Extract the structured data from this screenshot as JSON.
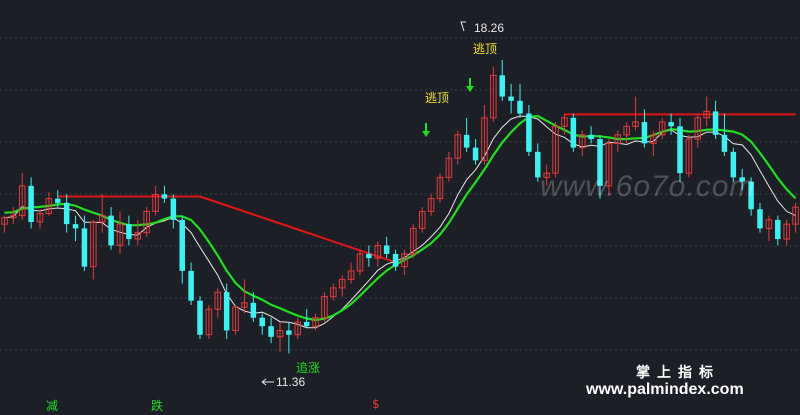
{
  "chart_data": {
    "type": "candlestick",
    "colors": {
      "up": "#e23b3b",
      "down": "#3ff0f0",
      "ma_white": "#e8e8e8",
      "ma_green": "#22dd22",
      "resistance": "#e01515",
      "grid": "#3a3f4a",
      "label_yellow": "#f0e030",
      "label_green": "#22dd22",
      "arrow_green": "#22dd22"
    },
    "grid": "dotted-horizontal",
    "price_range": [
      10.5,
      19.2
    ],
    "candles": [
      [
        14.4,
        14.6,
        14.2,
        14.55
      ],
      [
        14.55,
        14.8,
        14.4,
        14.6
      ],
      [
        14.6,
        15.6,
        14.5,
        15.3
      ],
      [
        15.3,
        15.5,
        14.3,
        14.45
      ],
      [
        14.45,
        14.75,
        14.3,
        14.65
      ],
      [
        14.65,
        15.15,
        14.6,
        15.0
      ],
      [
        15.0,
        15.2,
        14.8,
        14.9
      ],
      [
        14.9,
        15.1,
        14.2,
        14.4
      ],
      [
        14.4,
        14.6,
        14.0,
        14.3
      ],
      [
        14.3,
        14.6,
        13.3,
        13.4
      ],
      [
        13.4,
        14.5,
        13.1,
        14.45
      ],
      [
        14.45,
        15.1,
        14.2,
        14.6
      ],
      [
        14.6,
        14.8,
        13.8,
        13.9
      ],
      [
        13.9,
        14.7,
        13.7,
        14.4
      ],
      [
        14.4,
        14.6,
        13.9,
        14.05
      ],
      [
        14.05,
        14.5,
        13.9,
        14.2
      ],
      [
        14.2,
        14.8,
        14.1,
        14.7
      ],
      [
        14.7,
        15.3,
        14.6,
        15.1
      ],
      [
        15.1,
        15.3,
        14.9,
        15.0
      ],
      [
        15.0,
        15.1,
        14.3,
        14.5
      ],
      [
        14.5,
        14.6,
        13.0,
        13.3
      ],
      [
        13.3,
        13.5,
        12.5,
        12.6
      ],
      [
        12.6,
        12.7,
        11.7,
        11.8
      ],
      [
        11.8,
        12.5,
        11.7,
        12.4
      ],
      [
        12.4,
        12.9,
        12.2,
        12.8
      ],
      [
        12.8,
        13.0,
        11.7,
        11.9
      ],
      [
        11.9,
        12.5,
        11.8,
        12.45
      ],
      [
        12.45,
        13.1,
        12.3,
        12.55
      ],
      [
        12.55,
        12.8,
        12.1,
        12.2
      ],
      [
        12.2,
        12.3,
        11.8,
        12.0
      ],
      [
        12.0,
        12.2,
        11.6,
        11.75
      ],
      [
        11.75,
        12.1,
        11.4,
        11.9
      ],
      [
        11.9,
        12.1,
        11.36,
        11.8
      ],
      [
        11.8,
        12.2,
        11.7,
        12.1
      ],
      [
        12.1,
        12.4,
        11.95,
        12.0
      ],
      [
        12.0,
        12.3,
        11.9,
        12.2
      ],
      [
        12.2,
        12.8,
        12.1,
        12.7
      ],
      [
        12.7,
        13.0,
        12.6,
        12.9
      ],
      [
        12.9,
        13.2,
        12.7,
        13.1
      ],
      [
        13.1,
        13.5,
        13.0,
        13.3
      ],
      [
        13.3,
        13.8,
        13.2,
        13.7
      ],
      [
        13.7,
        13.9,
        13.4,
        13.6
      ],
      [
        13.6,
        14.0,
        13.4,
        13.9
      ],
      [
        13.9,
        14.1,
        13.6,
        13.7
      ],
      [
        13.7,
        13.8,
        13.3,
        13.4
      ],
      [
        13.4,
        13.8,
        13.2,
        13.7
      ],
      [
        13.7,
        14.4,
        13.6,
        14.3
      ],
      [
        14.3,
        14.8,
        14.2,
        14.7
      ],
      [
        14.7,
        15.1,
        14.6,
        15.0
      ],
      [
        15.0,
        15.6,
        14.9,
        15.5
      ],
      [
        15.5,
        16.1,
        15.4,
        15.95
      ],
      [
        15.95,
        16.6,
        15.8,
        16.5
      ],
      [
        16.5,
        16.9,
        16.1,
        16.2
      ],
      [
        16.2,
        16.4,
        15.8,
        15.9
      ],
      [
        15.9,
        17.2,
        15.8,
        16.9
      ],
      [
        16.9,
        18.1,
        16.8,
        17.9
      ],
      [
        17.9,
        18.26,
        17.3,
        17.4
      ],
      [
        17.4,
        17.7,
        17.0,
        17.3
      ],
      [
        17.3,
        17.7,
        16.9,
        17.0
      ],
      [
        17.0,
        17.2,
        16.0,
        16.1
      ],
      [
        16.1,
        16.3,
        15.4,
        15.5
      ],
      [
        15.5,
        15.8,
        15.3,
        15.6
      ],
      [
        15.6,
        16.8,
        15.5,
        16.7
      ],
      [
        16.7,
        17.0,
        16.5,
        16.9
      ],
      [
        16.9,
        17.0,
        16.1,
        16.2
      ],
      [
        16.2,
        16.6,
        16.0,
        16.5
      ],
      [
        16.5,
        16.7,
        16.3,
        16.4
      ],
      [
        16.4,
        16.5,
        15.0,
        15.3
      ],
      [
        15.3,
        16.4,
        15.1,
        16.3
      ],
      [
        16.3,
        16.6,
        16.1,
        16.5
      ],
      [
        16.5,
        16.8,
        16.3,
        16.7
      ],
      [
        16.7,
        17.4,
        16.6,
        16.8
      ],
      [
        16.8,
        17.1,
        16.2,
        16.3
      ],
      [
        16.3,
        16.6,
        16.0,
        16.5
      ],
      [
        16.5,
        16.9,
        16.4,
        16.8
      ],
      [
        16.8,
        17.0,
        16.5,
        16.7
      ],
      [
        16.7,
        16.9,
        15.4,
        15.6
      ],
      [
        15.6,
        16.5,
        15.5,
        16.4
      ],
      [
        16.4,
        17.0,
        16.2,
        16.9
      ],
      [
        16.9,
        17.4,
        16.7,
        17.05
      ],
      [
        17.05,
        17.3,
        16.4,
        16.5
      ],
      [
        16.5,
        17.0,
        16.0,
        16.1
      ],
      [
        16.1,
        16.2,
        15.4,
        15.5
      ],
      [
        15.5,
        15.7,
        15.2,
        15.4
      ],
      [
        15.4,
        15.5,
        14.6,
        14.75
      ],
      [
        14.75,
        14.9,
        14.2,
        14.3
      ],
      [
        14.3,
        14.6,
        14.0,
        14.5
      ],
      [
        14.5,
        14.6,
        13.9,
        14.05
      ],
      [
        14.05,
        14.5,
        13.9,
        14.4
      ],
      [
        14.4,
        14.9,
        14.2,
        14.8
      ]
    ],
    "high_marker": "18.26",
    "low_marker": "11.36",
    "annotations": [
      "逃顶",
      "逃顶",
      "追涨"
    ],
    "signals": [
      "减",
      "跌",
      "$"
    ]
  },
  "watermarks": {
    "site_top": "www.6o7o.com",
    "brand": "掌上指标",
    "site_bottom": "www.palmindex.com"
  }
}
